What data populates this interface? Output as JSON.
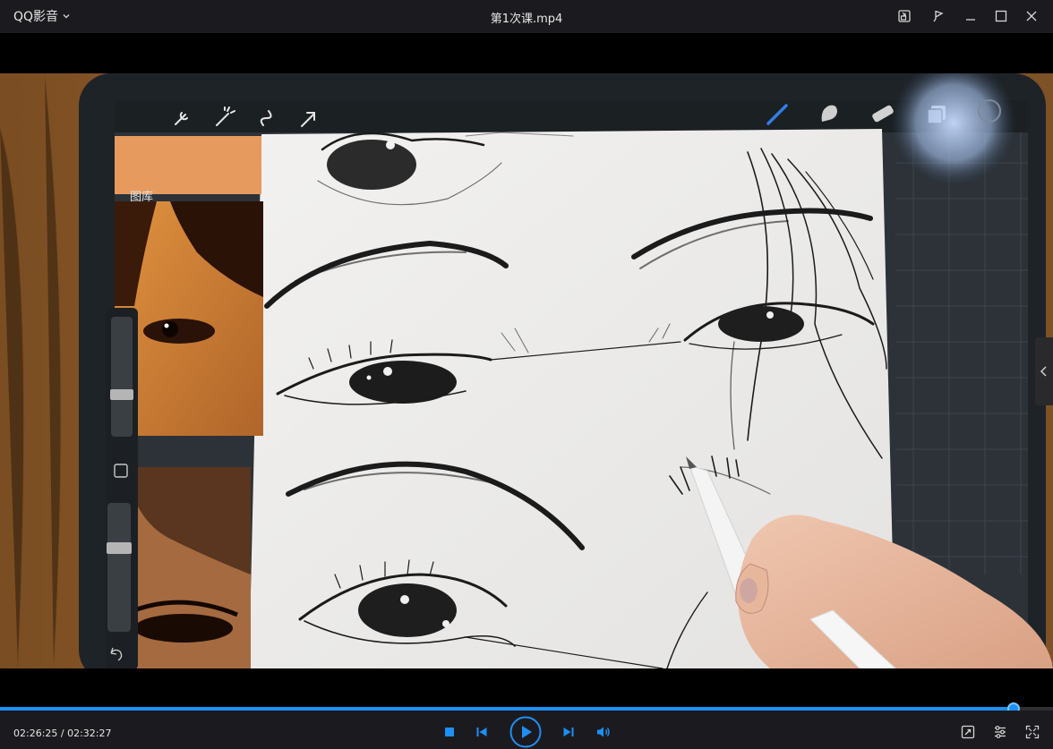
{
  "app": {
    "menu_label": "QQ影音",
    "window_title": "第1次课.mp4"
  },
  "window_controls": [
    "mini-mode",
    "pin",
    "minimize",
    "maximize",
    "close"
  ],
  "video": {
    "procreate_toolbar": {
      "gallery_label": "图库",
      "left_tools": [
        "wrench-icon",
        "magic-wand-icon",
        "selection-icon",
        "transform-arrow-icon"
      ],
      "right_tools": [
        "brush-icon",
        "smudge-icon",
        "eraser-icon",
        "layers-icon",
        "color-circle"
      ]
    }
  },
  "playback": {
    "current_time": "02:26:25",
    "separator": " / ",
    "total_time": "02:32:27",
    "time_display": "02:26:25 / 02:32:27",
    "progress_fraction": 0.9624,
    "accent_color": "#1e8ff5"
  },
  "bottom_controls": {
    "center": [
      "stop",
      "previous",
      "play",
      "next",
      "volume"
    ],
    "right": [
      "screenshot",
      "settings",
      "fullscreen"
    ]
  }
}
